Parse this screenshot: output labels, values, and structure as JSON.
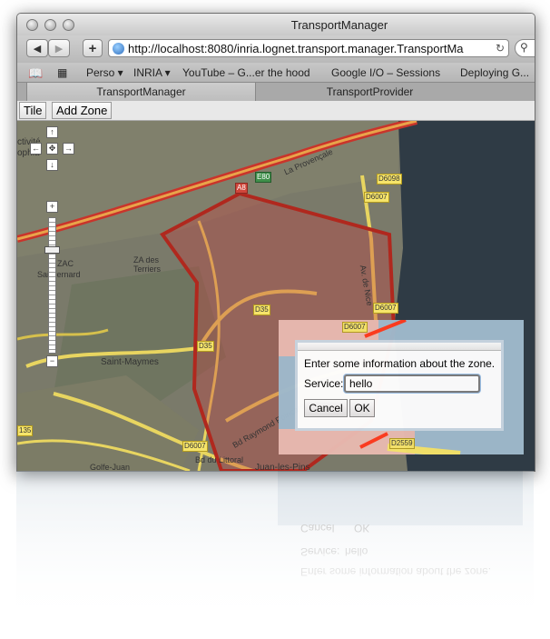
{
  "window": {
    "title": "TransportManager"
  },
  "toolbar": {
    "back_icon": "back-arrow-icon",
    "forward_icon": "forward-arrow-icon",
    "add_icon": "plus-icon",
    "url": "http://localhost:8080/inria.lognet.transport.manager.TransportMa",
    "reload_icon": "reload-icon",
    "search_icon": "search-icon"
  },
  "bookmarks": {
    "items": [
      {
        "label": "Perso ▾"
      },
      {
        "label": "INRIA ▾"
      },
      {
        "label": "YouTube – G...er the hood"
      },
      {
        "label": "Google I/O – Sessions"
      },
      {
        "label": "Deploying G..."
      }
    ]
  },
  "tabs": [
    {
      "label": "TransportManager",
      "active": true
    },
    {
      "label": "TransportProvider",
      "active": false
    }
  ],
  "app_toolbar": {
    "tile_label": "Tile",
    "add_zone_label": "Add Zone"
  },
  "map": {
    "labels": {
      "activite": "ctivité",
      "sophia": "ophia",
      "zac": "ZAC",
      "saint_bernard": "Sai Bernard",
      "za_des_terriers": "ZA des\nTerriers",
      "saint_maymes": "Saint-Maymes",
      "la_provencale": "La Provençale",
      "bd_raymond": "Bd Raymond Poincaré",
      "littoral": "Bd du Littoral",
      "juan_les_pins": "Juan-les-Pins",
      "golfe_juan": "Golfe-Juan",
      "av_nice": "Av. de Nice"
    },
    "roads": {
      "d6098": "D6098",
      "d6007_a": "D6007",
      "d6007_b": "D6007",
      "d6007_c": "D6007",
      "a8": "A8",
      "e80": "E80",
      "d35": "D35",
      "d35_b": "D35",
      "d135": "135",
      "d6007_d": "D6007",
      "d2559": "D2559"
    },
    "zone_color": "#c0392b",
    "sea_color": "#2f3b45"
  },
  "dialog": {
    "message": "Enter some information about the zone.",
    "service_label": "Service:",
    "service_value": "hello",
    "cancel_label": "Cancel",
    "ok_label": "OK"
  }
}
